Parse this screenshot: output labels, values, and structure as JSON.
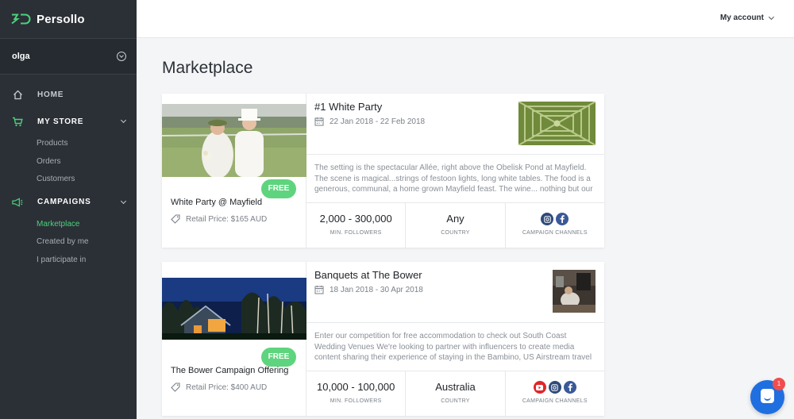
{
  "brand": {
    "name": "Persollo"
  },
  "user": {
    "name": "olga"
  },
  "nav": {
    "home": "HOME",
    "my_store": "MY STORE",
    "store_items": [
      "Products",
      "Orders",
      "Customers"
    ],
    "campaigns": "CAMPAIGNS",
    "campaign_items": [
      "Marketplace",
      "Created by me",
      "I participate in"
    ]
  },
  "topbar": {
    "account": "My account"
  },
  "page": {
    "title": "Marketplace"
  },
  "colors": {
    "accent": "#4cd07d",
    "sidebar": "#2b3036",
    "free_badge": "#5fd47f",
    "chat": "#1f6fe0"
  },
  "cards": [
    {
      "badge": "FREE",
      "offer_title": "White Party @ Mayfield",
      "retail": "Retail Price: $165 AUD",
      "title": "#1 White Party",
      "dates": "22 Jan 2018 - 22 Feb 2018",
      "description": "The setting is the spectacular Allée, right above the Obelisk Pond at Mayfield. The scene is magical...strings of festoon lights, long white tables. The food is a generous, communal, a home grown Mayfield feast. The wine... nothing but our",
      "followers": "2,000 - 300,000",
      "followers_label": "MIN. FOLLOWERS",
      "country": "Any",
      "country_label": "COUNTRY",
      "channels_label": "CAMPAIGN CHANNELS",
      "channels": [
        "instagram-icon",
        "facebook-icon"
      ]
    },
    {
      "badge": "FREE",
      "offer_title": "The Bower Campaign Offering",
      "retail": "Retail Price: $400 AUD",
      "title": "Banquets at The Bower",
      "dates": "18 Jan 2018 - 30 Apr 2018",
      "description": "Enter our competition for free accommodation to check out South Coast Wedding Venues  We're looking to partner with influencers to create media content sharing their experience of staying in the Bambino, US Airstream travel trailer,",
      "followers": "10,000 - 100,000",
      "followers_label": "MIN. FOLLOWERS",
      "country": "Australia",
      "country_label": "COUNTRY",
      "channels_label": "CAMPAIGN CHANNELS",
      "channels": [
        "youtube-icon",
        "instagram-icon",
        "facebook-icon"
      ]
    }
  ],
  "chat": {
    "badge": "1"
  }
}
